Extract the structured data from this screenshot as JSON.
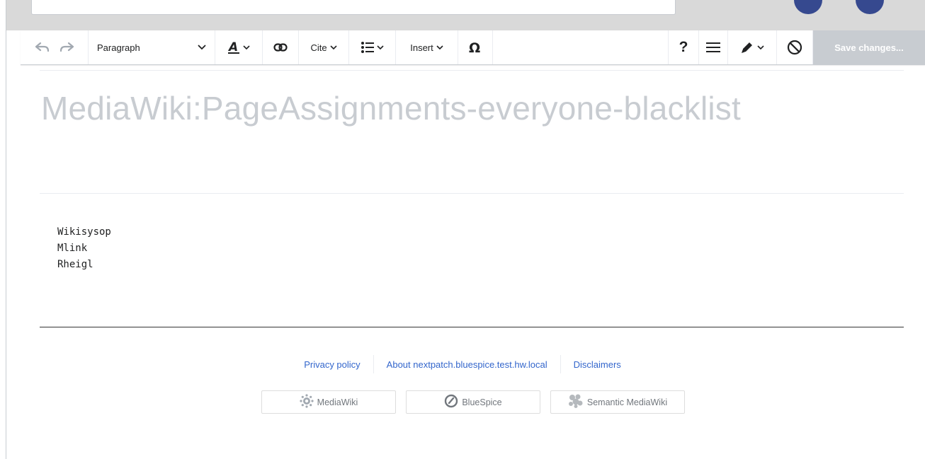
{
  "toolbar": {
    "format_label": "Paragraph",
    "cite_label": "Cite",
    "insert_label": "Insert",
    "help_label": "?",
    "save_label": "Save changes..."
  },
  "page": {
    "title": "MediaWiki:PageAssignments-everyone-blacklist",
    "lines": [
      "Wikisysop",
      "Mlink",
      "Rheigl"
    ]
  },
  "footer": {
    "links": [
      "Privacy policy",
      "About nextpatch.bluespice.test.hw.local",
      "Disclaimers"
    ],
    "badges": [
      "MediaWiki",
      "BlueSpice",
      "Semantic MediaWiki"
    ]
  },
  "colors": {
    "accent_link": "#3366cc",
    "avatar": "#36498f",
    "save_disabled": "#c8ccd1"
  }
}
